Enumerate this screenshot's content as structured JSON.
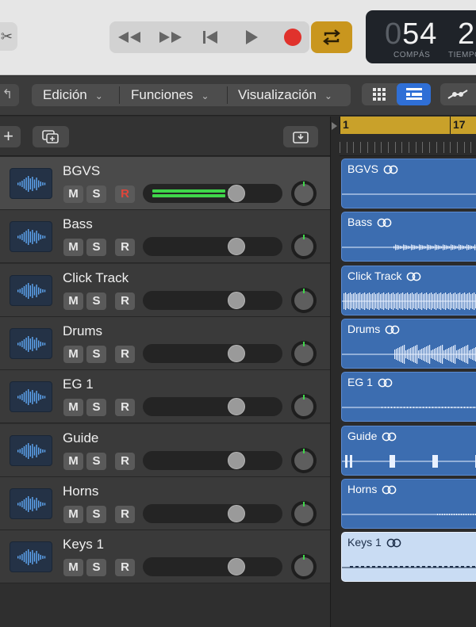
{
  "transport": {
    "controls": [
      "rewind",
      "fast-forward",
      "go-to-beginning",
      "play",
      "record",
      "cycle"
    ],
    "lcd": {
      "bar_dim": "0",
      "bar": "54",
      "beat": "2",
      "bar_label": "COMPÁS",
      "beat_label": "TIEMPO"
    }
  },
  "menubar": {
    "items": [
      {
        "label": "Edición"
      },
      {
        "label": "Funciones"
      },
      {
        "label": "Visualización"
      }
    ]
  },
  "tracks": [
    {
      "name": "BGVS",
      "mute": "M",
      "solo": "S",
      "rec": "R",
      "rec_armed": true,
      "selected": true,
      "level": 0.72,
      "metering": true
    },
    {
      "name": "Bass",
      "mute": "M",
      "solo": "S",
      "rec": "R",
      "rec_armed": false,
      "selected": false,
      "level": 0.72,
      "metering": false
    },
    {
      "name": "Click Track",
      "mute": "M",
      "solo": "S",
      "rec": "R",
      "rec_armed": false,
      "selected": false,
      "level": 0.72,
      "metering": false
    },
    {
      "name": "Drums",
      "mute": "M",
      "solo": "S",
      "rec": "R",
      "rec_armed": false,
      "selected": false,
      "level": 0.72,
      "metering": false
    },
    {
      "name": "EG 1",
      "mute": "M",
      "solo": "S",
      "rec": "R",
      "rec_armed": false,
      "selected": false,
      "level": 0.72,
      "metering": false
    },
    {
      "name": "Guide",
      "mute": "M",
      "solo": "S",
      "rec": "R",
      "rec_armed": false,
      "selected": false,
      "level": 0.72,
      "metering": false
    },
    {
      "name": "Horns",
      "mute": "M",
      "solo": "S",
      "rec": "R",
      "rec_armed": false,
      "selected": false,
      "level": 0.72,
      "metering": false
    },
    {
      "name": "Keys 1",
      "mute": "M",
      "solo": "S",
      "rec": "R",
      "rec_armed": false,
      "selected": false,
      "level": 0.72,
      "metering": false
    }
  ],
  "ruler": {
    "markers": [
      "1",
      "17"
    ]
  },
  "regions": [
    {
      "name": "BGVS",
      "wave": "flat",
      "selected": false
    },
    {
      "name": "Bass",
      "wave": "bass",
      "selected": false
    },
    {
      "name": "Click Track",
      "wave": "dense",
      "selected": false
    },
    {
      "name": "Drums",
      "wave": "drums",
      "selected": false
    },
    {
      "name": "EG 1",
      "wave": "thin",
      "selected": false
    },
    {
      "name": "Guide",
      "wave": "guide",
      "selected": false
    },
    {
      "name": "Horns",
      "wave": "late",
      "selected": false
    },
    {
      "name": "Keys 1",
      "wave": "dashes",
      "selected": true
    }
  ],
  "colors": {
    "accent_blue": "#2f6fd6",
    "cycle_gold": "#c9961e",
    "record_red": "#e0322c",
    "meter_green": "#3fd64a",
    "region_blue": "#3c6db0",
    "region_selected": "#c9dcf3"
  }
}
